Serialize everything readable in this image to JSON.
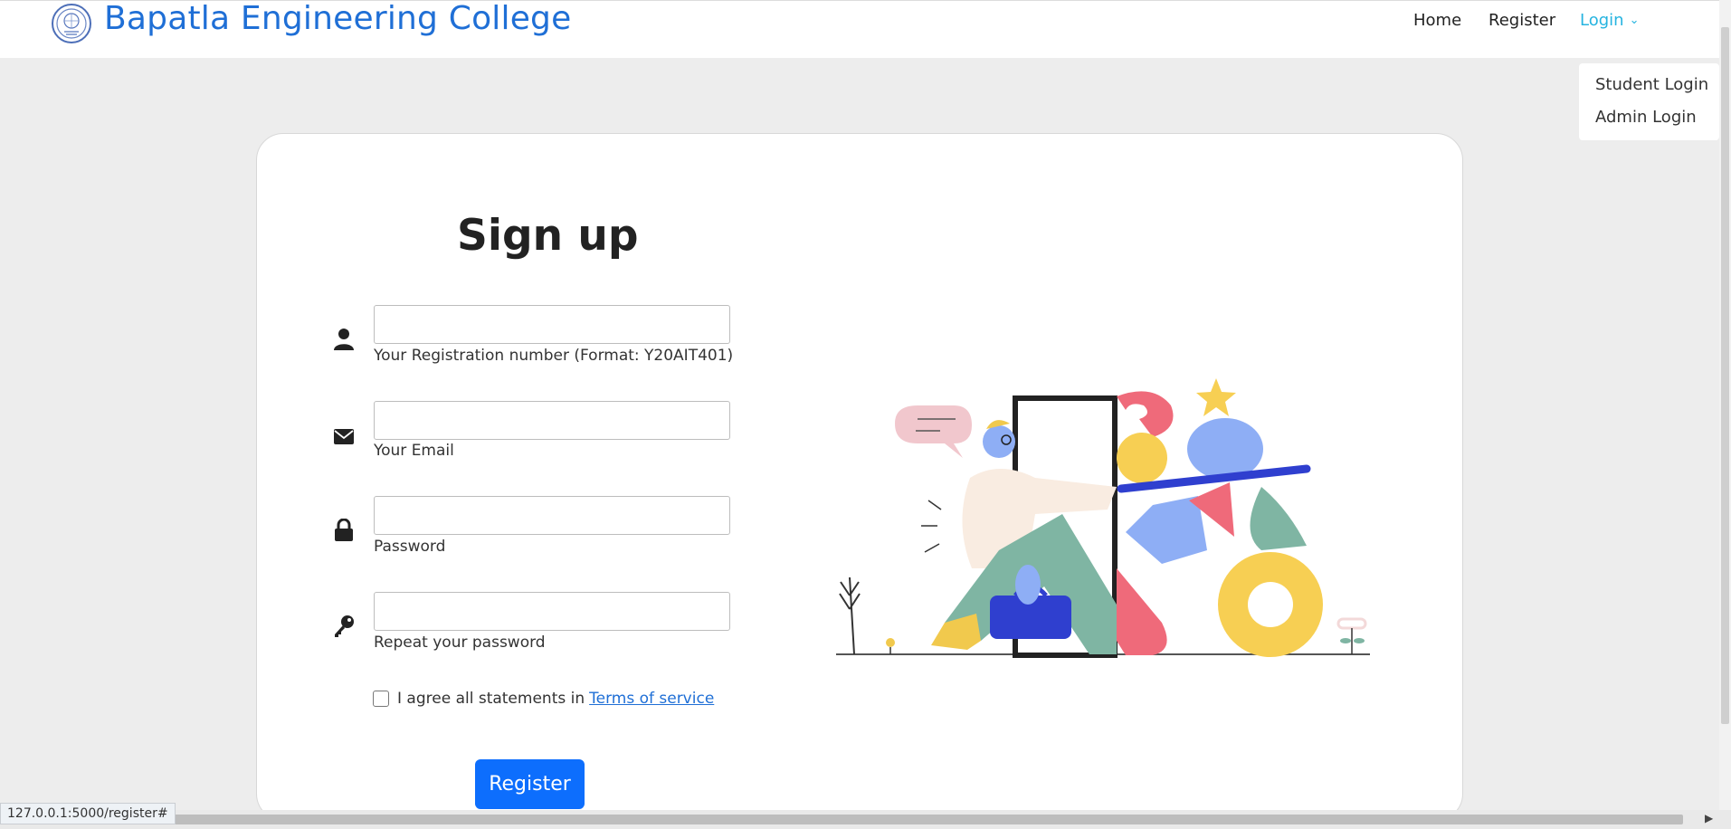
{
  "navbar": {
    "brand": "Bapatla Engineering College",
    "links": {
      "home": "Home",
      "register": "Register",
      "login": "Login"
    },
    "login_dropdown": {
      "student": "Student Login",
      "admin": "Admin Login"
    }
  },
  "form": {
    "title": "Sign up",
    "fields": {
      "registration": {
        "hint": "Your Registration number (Format: Y20AIT401)",
        "value": "",
        "icon": "user-icon"
      },
      "email": {
        "hint": "Your Email",
        "value": "",
        "icon": "envelope-icon"
      },
      "password": {
        "hint": "Password",
        "value": "",
        "icon": "lock-icon"
      },
      "repeat_password": {
        "hint": "Repeat your password",
        "value": "",
        "icon": "key-icon"
      }
    },
    "agree_text": "I agree all statements in",
    "terms_link": "Terms of service",
    "submit": "Register"
  },
  "status_bar": {
    "url": "127.0.0.1:5000/register#"
  },
  "colors": {
    "brand": "#1f6fd6",
    "active_nav": "#26b4e0",
    "primary_button": "#0d6efd",
    "page_background": "#ededed"
  }
}
